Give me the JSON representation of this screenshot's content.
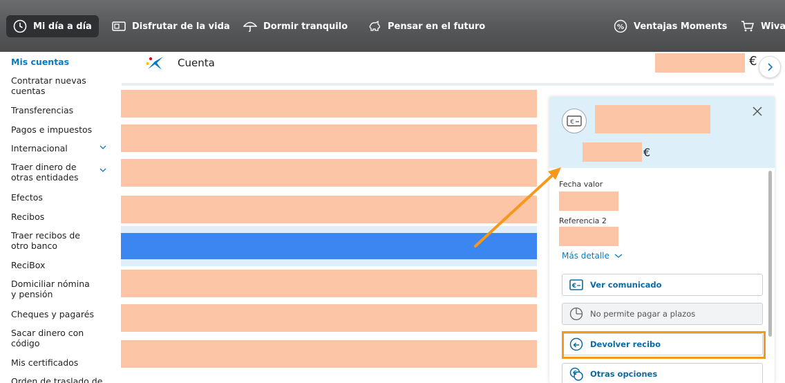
{
  "nav": {
    "items": [
      {
        "label": "Mi día a día",
        "icon": "clock-icon"
      },
      {
        "label": "Disfrutar de la vida",
        "icon": "ticket-icon"
      },
      {
        "label": "Dormir tranquilo",
        "icon": "umbrella-icon"
      },
      {
        "label": "Pensar en el futuro",
        "icon": "piggy-bank-icon"
      },
      {
        "label": "Ventajas Moments",
        "icon": "percent-icon"
      },
      {
        "label": "Wiva",
        "icon": "cart-icon"
      }
    ]
  },
  "sidebar": {
    "items": [
      {
        "label": "Mis cuentas"
      },
      {
        "label": "Contratar nuevas cuentas"
      },
      {
        "label": "Transferencias"
      },
      {
        "label": "Pagos e impuestos"
      },
      {
        "label": "Internacional"
      },
      {
        "label": "Traer dinero de otras entidades"
      },
      {
        "label": "Efectos"
      },
      {
        "label": "Recibos"
      },
      {
        "label": "Traer recibos de otro banco"
      },
      {
        "label": "ReciBox"
      },
      {
        "label": "Domiciliar nómina y pensión"
      },
      {
        "label": "Cheques y pagarés"
      },
      {
        "label": "Sacar dinero con código"
      },
      {
        "label": "Mis certificados"
      },
      {
        "label": "Orden de traslado de"
      }
    ]
  },
  "header": {
    "title": "Cuenta",
    "currency": "€"
  },
  "detail": {
    "currency": "€",
    "fecha_label": "Fecha valor",
    "ref_label": "Referencia 2",
    "mas_detalle": "Más detalle",
    "actions": [
      {
        "label": "Ver comunicado",
        "icon": "euro-card-icon"
      },
      {
        "label": "No permite pagar a plazos",
        "icon": "pie-chart-icon"
      },
      {
        "label": "Devolver recibo",
        "icon": "return-arrow-icon"
      },
      {
        "label": "Otras opciones",
        "icon": "euro-coins-icon"
      }
    ]
  },
  "colors": {
    "accent": "#0a7bc2",
    "highlight": "#f7981d",
    "selected_row": "#3b86f0",
    "redaction": "#fbc5a6"
  }
}
